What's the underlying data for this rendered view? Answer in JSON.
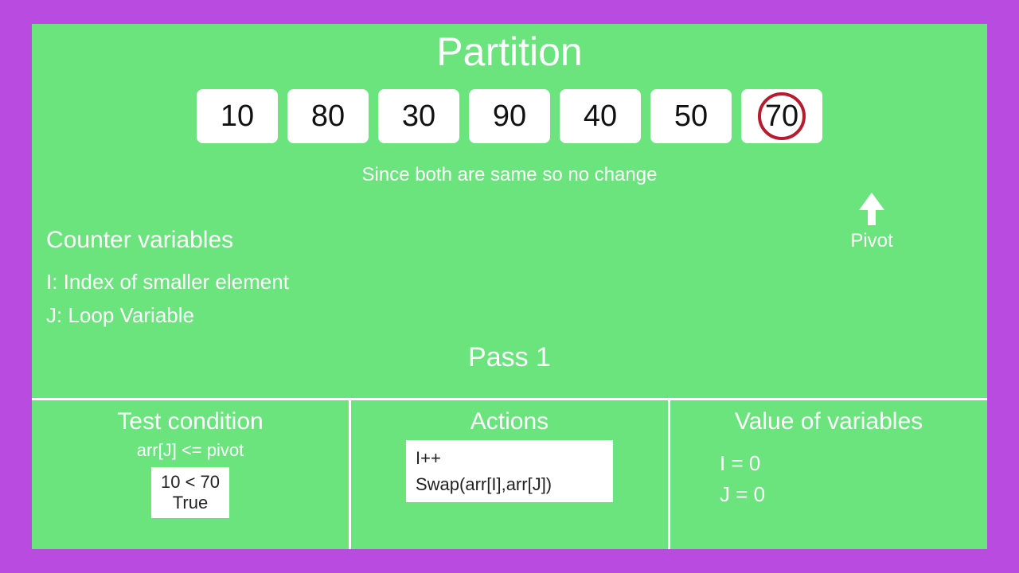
{
  "title": "Partition",
  "array": [
    "10",
    "80",
    "30",
    "90",
    "40",
    "50",
    "70"
  ],
  "pivot_index": 6,
  "pivot_label": "Pivot",
  "message": "Since both are same so no change",
  "counter": {
    "heading": "Counter variables",
    "line_i": "I: Index of smaller element",
    "line_j": "J: Loop Variable"
  },
  "pass_label": "Pass 1",
  "bottom": {
    "test": {
      "heading": "Test condition",
      "sub": "arr[J] <= pivot",
      "box_line1": "10 < 70",
      "box_line2": "True"
    },
    "actions": {
      "heading": "Actions",
      "box_line1": "I++",
      "box_line2": "Swap(arr[I],arr[J])"
    },
    "vars": {
      "heading": "Value of variables",
      "line_i": "I  =  0",
      "line_j": "J  =  0"
    }
  }
}
